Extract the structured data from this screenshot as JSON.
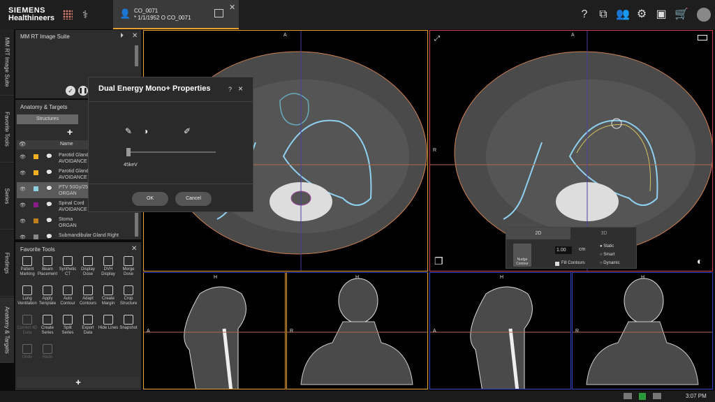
{
  "header": {
    "logo_line1": "SIEMENS",
    "logo_line2": "Healthineers",
    "patient_tab": {
      "line1": "CO_0071",
      "line2": "* 1/1/1952 O CO_0071"
    },
    "icons": [
      "help-icon",
      "monitor-icon",
      "users-icon",
      "gear-icon",
      "toolbox-icon",
      "cart-icon",
      "user-avatar-icon"
    ]
  },
  "vtabs": [
    "MM RT Image Suite",
    "Favorite Tools",
    "Series",
    "Findings",
    "Anatomy & Targets"
  ],
  "suite_panel": {
    "title": "MM RT Image Suite"
  },
  "anatomy_panel": {
    "title": "Anatomy & Targets",
    "tab": "Structures",
    "column": "Name",
    "rows": [
      {
        "name": "Parotid Gland",
        "type": "AVOIDANCE",
        "color": "#f0b020"
      },
      {
        "name": "Parotid Gland",
        "type": "AVOIDANCE",
        "color": "#f0b020"
      },
      {
        "name": "PTV 50Gy/25",
        "type": "ORGAN",
        "color": "#8fd0e0"
      },
      {
        "name": "Spinal Cord",
        "type": "AVOIDANCE",
        "color": "#8a1a8a"
      },
      {
        "name": "Stoma",
        "type": "ORGAN",
        "color": "#c08020"
      },
      {
        "name": "Submandibular Gland Right",
        "type": "",
        "color": "#888888"
      }
    ]
  },
  "fav_panel": {
    "title": "Favorite Tools",
    "tools": [
      "Patient Marking",
      "Beam Placement",
      "Synthetic CT",
      "Display Dose",
      "DVH Display",
      "Merge Dose",
      "Lung Ventilation",
      "Apply Template",
      "Auto Contour",
      "Adapt Contours",
      "Create Margin",
      "Crop Structure",
      "Correct 4D Data",
      "Create Series",
      "Split Series",
      "Export Data",
      "Hide Lines",
      "Snapshot",
      "Undo",
      "Redo"
    ],
    "disabled": [
      "Correct 4D Data",
      "Undo",
      "Redo"
    ]
  },
  "dialog": {
    "title": "Dual Energy Mono+ Properties",
    "help": "?",
    "close": "×",
    "slider_value": "45keV",
    "slider_fraction": 0.02,
    "ok": "OK",
    "cancel": "Cancel"
  },
  "viewports": {
    "label_a": "A",
    "label_r": "R",
    "label_h": "H"
  },
  "contour_popup": {
    "tab_2d": "2D",
    "tab_3d": "3D",
    "nudge": "Nudge Contour",
    "value": "1.00",
    "unit": "cm",
    "fill": "Fill Contours",
    "opt1": "Static",
    "opt2": "Smart",
    "opt3": "Dynamic"
  },
  "status": {
    "time": "3:07 PM"
  }
}
